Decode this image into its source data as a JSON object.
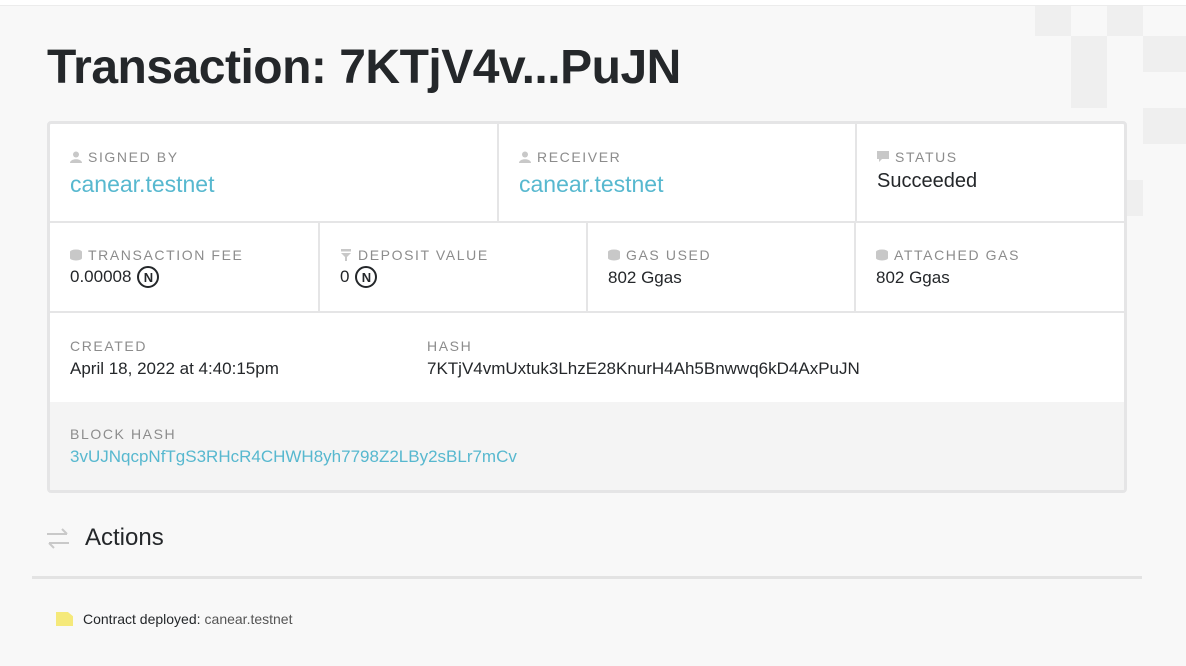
{
  "page": {
    "title": "Transaction: 7KTjV4v...PuJN"
  },
  "transaction": {
    "signed_by": {
      "label": "SIGNED BY",
      "value": "canear.testnet",
      "icon": "user-icon"
    },
    "receiver": {
      "label": "RECEIVER",
      "value": "canear.testnet",
      "icon": "user-icon"
    },
    "status": {
      "label": "STATUS",
      "value": "Succeeded",
      "icon": "comment-icon"
    },
    "transaction_fee": {
      "label": "TRANSACTION FEE",
      "value": "0.00008",
      "unit_icon": "near-icon",
      "icon": "coins-icon"
    },
    "deposit_value": {
      "label": "DEPOSIT VALUE",
      "value": "0",
      "unit_icon": "near-icon",
      "icon": "filter-icon"
    },
    "gas_used": {
      "label": "GAS USED",
      "value": "802 Ggas",
      "icon": "coins-icon"
    },
    "attached_gas": {
      "label": "ATTACHED GAS",
      "value": "802 Ggas",
      "icon": "coins-icon"
    },
    "created": {
      "label": "CREATED",
      "value": "April 18, 2022 at 4:40:15pm"
    },
    "hash": {
      "label": "HASH",
      "value": "7KTjV4vmUxtuk3LhzE28KnurH4Ah5Bnwwq6kD4AxPuJN"
    },
    "block_hash": {
      "label": "BLOCK HASH",
      "value": "3vUJNqcpNfTgS3RHcR4CHWH8yh7798Z2LBy2sBLr7mCv"
    }
  },
  "near_symbol": "N",
  "actions": {
    "title": "Actions",
    "icon": "transfer-arrows-icon",
    "items": [
      {
        "label": "Contract deployed:",
        "value": "canear.testnet",
        "icon": "contract-icon"
      }
    ]
  },
  "colors": {
    "link": "#57b8cf",
    "border": "#e5e5e6",
    "label": "#8c8c8c",
    "text": "#24272a",
    "action_icon": "#f5e97a"
  }
}
